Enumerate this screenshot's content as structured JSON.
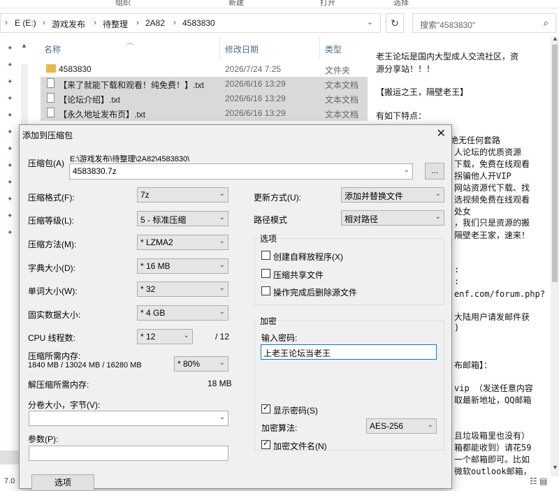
{
  "ribbon": {
    "items": [
      "组织",
      "新建",
      "打开",
      "选择"
    ]
  },
  "address": {
    "crumbs": [
      "E (E:)",
      "游戏发布",
      "待整理",
      "2A82",
      "4583830"
    ],
    "search_placeholder": "搜索\"4583830\""
  },
  "filelist": {
    "headers": {
      "name": "名称",
      "date": "修改日期",
      "type": "类型"
    },
    "rows": [
      {
        "name": "4583830",
        "date": "2026/7/24 7:25",
        "type": "文件夹",
        "kind": "folder"
      },
      {
        "name": "【来了就能下载和观看！纯免费！】.txt",
        "date": "2026/6/16 13:29",
        "type": "文本文档",
        "kind": "txt"
      },
      {
        "name": "【论坛介绍】.txt",
        "date": "2026/6/16 13:29",
        "type": "文本文档",
        "kind": "txt"
      },
      {
        "name": "【永久地址发布页】.txt",
        "date": "2026/6/16 13:29",
        "type": "文本文档",
        "kind": "txt"
      }
    ]
  },
  "preview": {
    "lines": [
      "老王论坛是国内大型成人交流社区，资",
      "源分享站！！！",
      "【搬运之王，隔壁老王】",
      "有如下特点：",
      "源，绝无任何套路",
      "人论坛的优质资源",
      "下载，免费在线观看",
      "拐骗他人开VIP",
      "网站资源代下载、找",
      "选视频免费在线观看",
      "处女",
      "，我们只是资源的搬",
      "隔壁老王家，速来！",
      ":",
      ":",
      "enf.com/forum.php?",
      "大陆用户请发邮件获",
      ")",
      "布邮箱】：",
      "vip  （发送任意内容",
      "取最新地址，QQ邮箱",
      "且垃圾箱里也没有）",
      "箱都能收到）请花59",
      "一个邮箱即可。比如",
      "微软outlook邮箱，"
    ]
  },
  "status": {
    "count": "7.0"
  },
  "dialog": {
    "title": "添加到压缩包",
    "archive_label": "压缩包(A)",
    "archive_path": "E:\\游戏发布\\待整理\\2A82\\4583830\\",
    "archive_name": "4583830.7z",
    "browse_label": "...",
    "format_label": "压缩格式(F):",
    "format_value": "7z",
    "level_label": "压缩等级(L):",
    "level_value": "5 - 标准压缩",
    "method_label": "压缩方法(M):",
    "method_value": "* LZMA2",
    "dict_label": "字典大小(D):",
    "dict_value": "* 16 MB",
    "word_label": "单词大小(W):",
    "word_value": "* 32",
    "solid_label": "固实数据大小:",
    "solid_value": "* 4 GB",
    "cpu_label": "CPU 线程数:",
    "cpu_value": "* 12",
    "cpu_total": "/ 12",
    "mem_label": "压缩所需内存:",
    "mem_info": "1840 MB / 13024 MB / 16280 MB",
    "mem_value": "* 80%",
    "decomp_label": "解压缩所需内存:",
    "decomp_value": "18 MB",
    "split_label": "分卷大小，字节(V):",
    "params_label": "参数(P):",
    "update_label": "更新方式(U):",
    "update_value": "添加并替换文件",
    "path_label": "路径模式",
    "path_value": "相对路径",
    "options_title": "选项",
    "opt_sfx": "创建自释放程序(X)",
    "opt_shared": "压缩共享文件",
    "opt_delete": "操作完成后删除源文件",
    "enc_title": "加密",
    "pwd_label": "输入密码:",
    "pwd_value": "上老王论坛当老王",
    "show_pwd": "显示密码(S)",
    "enc_method_label": "加密算法:",
    "enc_method_value": "AES-256",
    "enc_names": "加密文件名(N)",
    "options_button": "选项"
  }
}
